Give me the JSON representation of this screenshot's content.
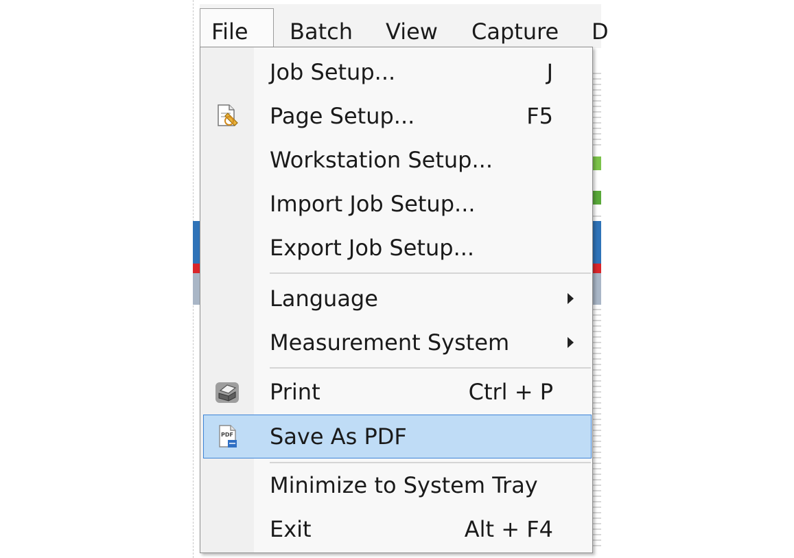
{
  "menubar": {
    "items": [
      {
        "label": "File",
        "active": true
      },
      {
        "label": "Batch"
      },
      {
        "label": "View"
      },
      {
        "label": "Capture"
      },
      {
        "label": "D"
      }
    ]
  },
  "file_menu": {
    "items": [
      {
        "label": "Job Setup...",
        "shortcut": "J"
      },
      {
        "label": "Page Setup...",
        "shortcut": "F5",
        "icon": "page-setup-icon"
      },
      {
        "label": "Workstation Setup..."
      },
      {
        "label": "Import Job Setup..."
      },
      {
        "label": "Export Job Setup..."
      },
      {
        "label": "Language",
        "submenu": true
      },
      {
        "label": "Measurement System",
        "submenu": true
      },
      {
        "label": "Print",
        "shortcut": "Ctrl + P",
        "icon": "printer-icon"
      },
      {
        "label": "Save As PDF",
        "icon": "pdf-icon",
        "highlighted": true
      },
      {
        "label": "Minimize to System Tray"
      },
      {
        "label": "Exit",
        "shortcut": "Alt + F4"
      }
    ],
    "pdf_icon_text": "PDF"
  },
  "colors": {
    "highlight_bg": "#bfdcf6",
    "highlight_border": "#3c83d6",
    "menu_bg": "#f8f8f8"
  }
}
